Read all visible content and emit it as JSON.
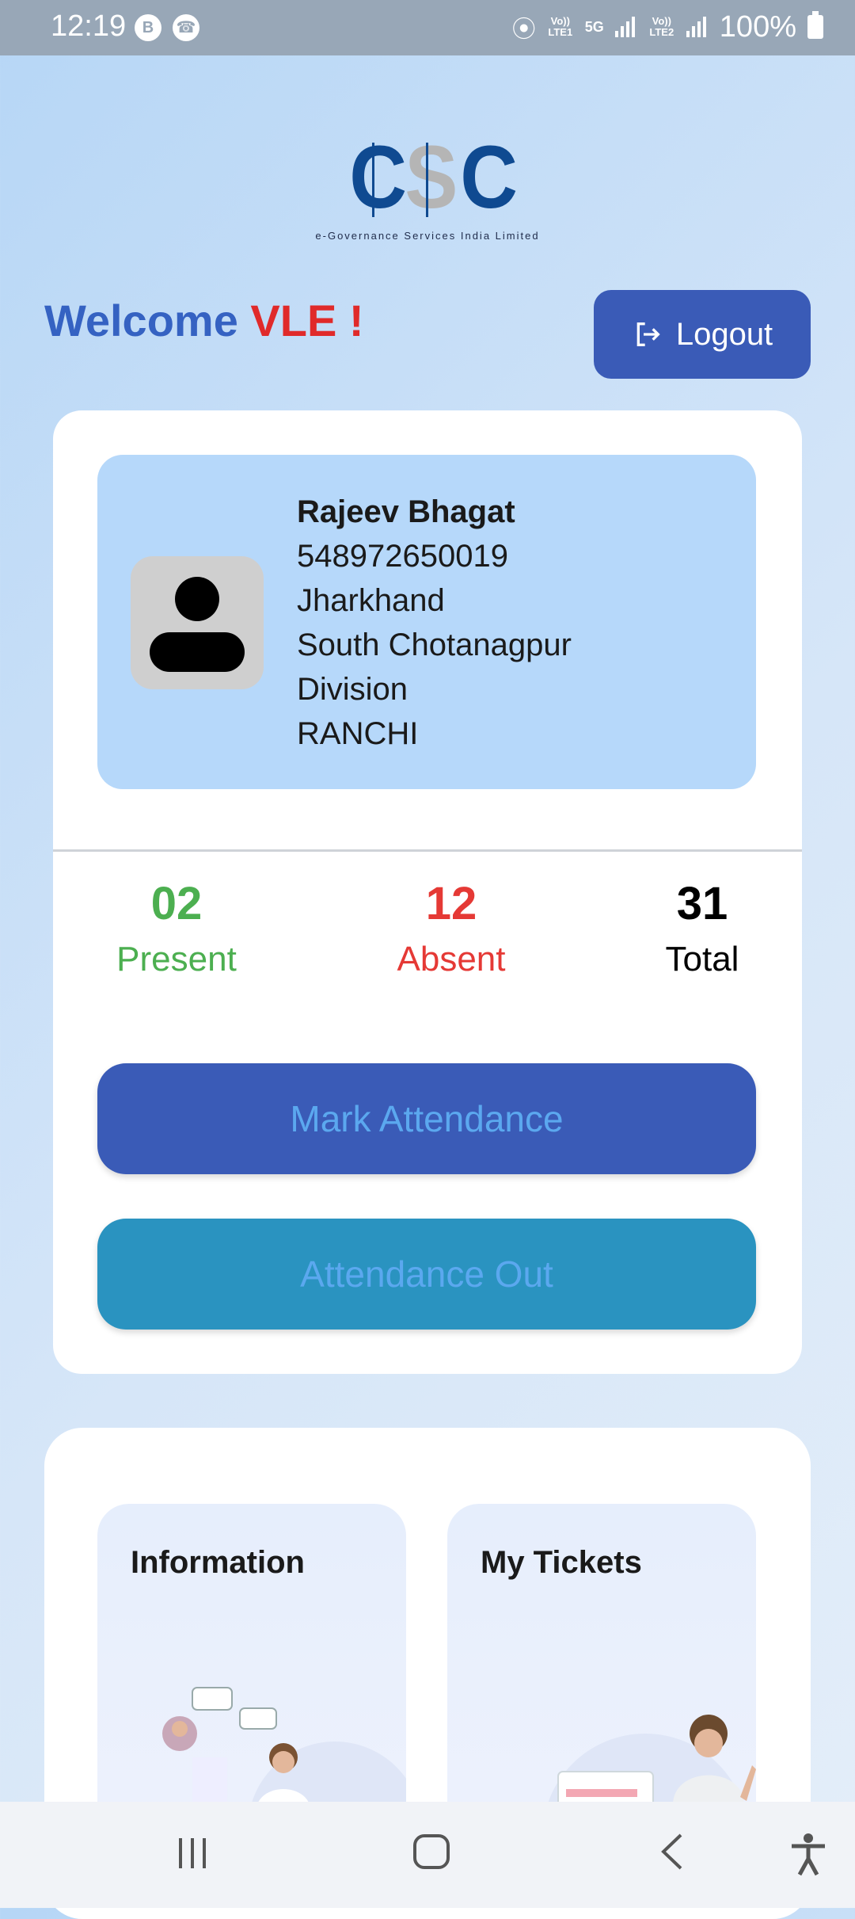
{
  "status_bar": {
    "time": "12:19",
    "left_icons": [
      "B",
      "phone"
    ],
    "battery": "100%",
    "net1": "Vo)) LTE1",
    "net2": "Vo)) LTE2",
    "net_5g": "5G"
  },
  "logo": {
    "letters": [
      "C",
      "S",
      "C"
    ],
    "tagline": "e-Governance Services India Limited"
  },
  "header": {
    "welcome": "Welcome",
    "user": "VLE !",
    "logout_label": "Logout"
  },
  "profile": {
    "name": "Rajeev Bhagat",
    "id": "548972650019",
    "state": "Jharkhand",
    "division_line1": "South Chotanagpur",
    "division_line2": "Division",
    "district": "RANCHI"
  },
  "stats": {
    "present_value": "02",
    "present_label": "Present",
    "absent_value": "12",
    "absent_label": "Absent",
    "total_value": "31",
    "total_label": "Total"
  },
  "actions": {
    "mark_attendance": "Mark Attendance",
    "attendance_out": "Attendance Out"
  },
  "tiles": [
    {
      "title": "Information"
    },
    {
      "title": "My Tickets"
    }
  ],
  "colors": {
    "primary": "#3a5bb7",
    "secondary": "#2a93c0",
    "present": "#4caf50",
    "absent": "#e53935",
    "welcome": "#3562c2",
    "vle": "#e02a2a"
  }
}
